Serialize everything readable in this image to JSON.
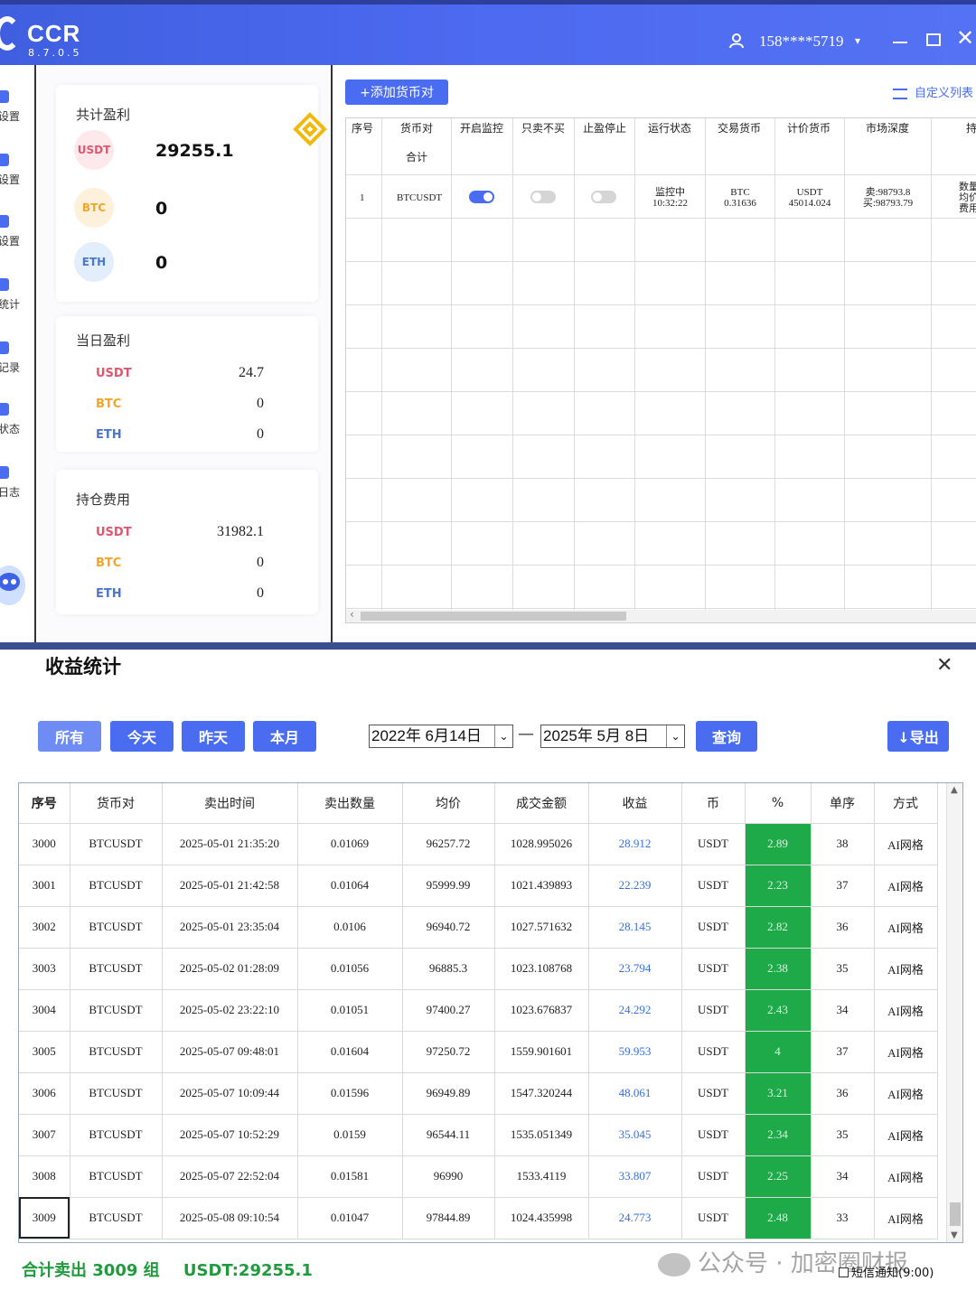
{
  "app": {
    "name": "CCR",
    "version": "8.7.0.5",
    "user": "158****5719",
    "colors": {
      "primary": "#4a6cf0",
      "profit_green": "#1faa4a",
      "header_bg": "#4d6af0"
    }
  },
  "nav": {
    "items": [
      {
        "label": "设置",
        "icon": "settings-icon"
      },
      {
        "label": "设置",
        "icon": "settings-icon"
      },
      {
        "label": "设置",
        "icon": "settings-icon"
      },
      {
        "label": "统计",
        "icon": "chart-icon"
      },
      {
        "label": "记录",
        "icon": "record-icon"
      },
      {
        "label": "状态",
        "icon": "status-icon"
      },
      {
        "label": "日志",
        "icon": "log-icon"
      }
    ]
  },
  "total_profit": {
    "title": "共计盈利",
    "usdt_label": "USDT",
    "usdt_value": "29255.1",
    "btc_label": "BTC",
    "btc_value": "0",
    "eth_label": "ETH",
    "eth_value": "0"
  },
  "daily_profit": {
    "title": "当日盈利",
    "usdt_label": "USDT",
    "usdt_value": "24.7",
    "btc_label": "BTC",
    "btc_value": "0",
    "eth_label": "ETH",
    "eth_value": "0"
  },
  "holding_fee": {
    "title": "持仓费用",
    "usdt_label": "USDT",
    "usdt_value": "31982.1",
    "btc_label": "BTC",
    "btc_value": "0",
    "eth_label": "ETH",
    "eth_value": "0"
  },
  "pairs_panel": {
    "add_button": "+添加货币对",
    "custom_list": "自定义列表",
    "headers": [
      "序号",
      "货币对",
      "开启监控",
      "只卖不买",
      "止盈停止",
      "运行状态",
      "交易货币",
      "计价货币",
      "市场深度",
      "持"
    ],
    "subheader": "合计",
    "row": {
      "idx": "1",
      "pair": "BTCUSDT",
      "monitor_on": true,
      "sell_only": false,
      "tp_stop": false,
      "status": "监控中",
      "status_time": "10:32:22",
      "trade_coin": "BTC",
      "trade_amount": "0.31636",
      "quote_coin": "USDT",
      "quote_amount": "45014.024",
      "depth_sell": "卖:98793.8",
      "depth_buy": "买:98793.79",
      "extra_1": "数量",
      "extra_2": "均价",
      "extra_3": "费用"
    }
  },
  "profit_dialog": {
    "title": "收益统计",
    "filters": [
      "所有",
      "今天",
      "昨天",
      "本月"
    ],
    "date_from": "2022年 6月14日",
    "date_to": "2025年  5月  8日",
    "date_sep": "—",
    "query": "查询",
    "export": "↓导出",
    "columns": [
      "序号",
      "货币对",
      "卖出时间",
      "卖出数量",
      "均价",
      "成交金额",
      "收益",
      "币",
      "%",
      "单序",
      "方式"
    ],
    "rows": [
      [
        "3000",
        "BTCUSDT",
        "2025-05-01 21:35:20",
        "0.01069",
        "96257.72",
        "1028.995026",
        "28.912",
        "USDT",
        "2.89",
        "38",
        "AI网格"
      ],
      [
        "3001",
        "BTCUSDT",
        "2025-05-01 21:42:58",
        "0.01064",
        "95999.99",
        "1021.439893",
        "22.239",
        "USDT",
        "2.23",
        "37",
        "AI网格"
      ],
      [
        "3002",
        "BTCUSDT",
        "2025-05-01 23:35:04",
        "0.0106",
        "96940.72",
        "1027.571632",
        "28.145",
        "USDT",
        "2.82",
        "36",
        "AI网格"
      ],
      [
        "3003",
        "BTCUSDT",
        "2025-05-02 01:28:09",
        "0.01056",
        "96885.3",
        "1023.108768",
        "23.794",
        "USDT",
        "2.38",
        "35",
        "AI网格"
      ],
      [
        "3004",
        "BTCUSDT",
        "2025-05-02 23:22:10",
        "0.01051",
        "97400.27",
        "1023.676837",
        "24.292",
        "USDT",
        "2.43",
        "34",
        "AI网格"
      ],
      [
        "3005",
        "BTCUSDT",
        "2025-05-07 09:48:01",
        "0.01604",
        "97250.72",
        "1559.901601",
        "59.953",
        "USDT",
        "4",
        "37",
        "AI网格"
      ],
      [
        "3006",
        "BTCUSDT",
        "2025-05-07 10:09:44",
        "0.01596",
        "96949.89",
        "1547.320244",
        "48.061",
        "USDT",
        "3.21",
        "36",
        "AI网格"
      ],
      [
        "3007",
        "BTCUSDT",
        "2025-05-07 10:52:29",
        "0.0159",
        "96544.11",
        "1535.051349",
        "35.045",
        "USDT",
        "2.34",
        "35",
        "AI网格"
      ],
      [
        "3008",
        "BTCUSDT",
        "2025-05-07 22:52:04",
        "0.01581",
        "96990",
        "1533.4119",
        "33.807",
        "USDT",
        "2.25",
        "34",
        "AI网格"
      ],
      [
        "3009",
        "BTCUSDT",
        "2025-05-08 09:10:54",
        "0.01047",
        "97844.89",
        "1024.435998",
        "24.773",
        "USDT",
        "2.48",
        "33",
        "AI网格"
      ]
    ],
    "footer_count": "合计卖出 3009 组",
    "footer_usdt": "USDT:29255.1",
    "sms_label": "短信通知(9:00)"
  },
  "watermark": "公众号 · 加密圈财报"
}
